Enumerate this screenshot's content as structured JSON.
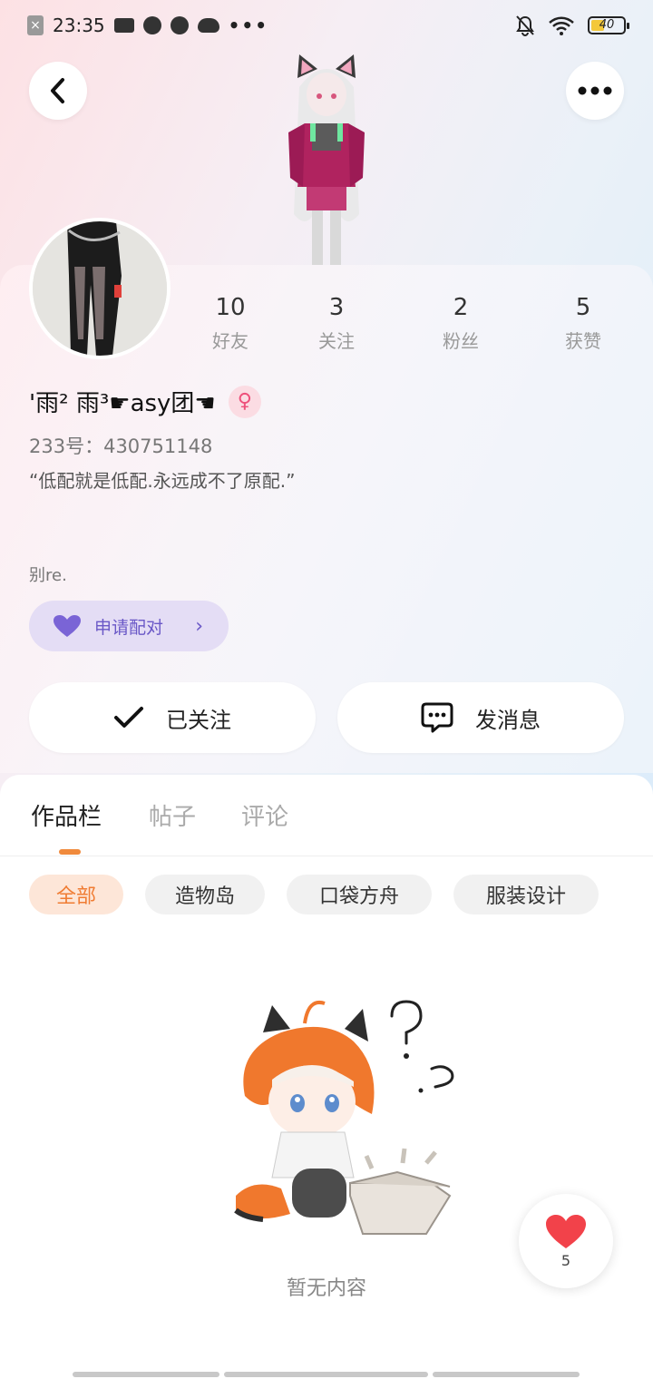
{
  "status_bar": {
    "time": "23:35",
    "dots": "•••",
    "battery": "40"
  },
  "profile": {
    "stats": [
      {
        "value": "10",
        "label": "好友"
      },
      {
        "value": "3",
        "label": "关注"
      },
      {
        "value": "2",
        "label": "粉丝"
      },
      {
        "value": "5",
        "label": "获赞"
      }
    ],
    "username": "'雨² 雨³☛asy团☚",
    "gender_symbol": "♀",
    "uid": "233号：430751148",
    "bio": "“低配就是低配.永远成不了原配.”",
    "tag": "别re.",
    "pair_label": "申请配对",
    "follow_label": "已关注",
    "message_label": "发消息"
  },
  "tabs": [
    {
      "label": "作品栏",
      "active": true
    },
    {
      "label": "帖子",
      "active": false
    },
    {
      "label": "评论",
      "active": false
    }
  ],
  "filters": [
    {
      "label": "全部",
      "active": true
    },
    {
      "label": "造物岛",
      "active": false
    },
    {
      "label": "口袋方舟",
      "active": false
    },
    {
      "label": "服装设计",
      "active": false
    }
  ],
  "empty_text": "暂无内容",
  "like_fab": {
    "count": "5"
  },
  "colors": {
    "accent": "#f08a3c",
    "pair": "#6a58c7",
    "heart": "#f2424a"
  }
}
